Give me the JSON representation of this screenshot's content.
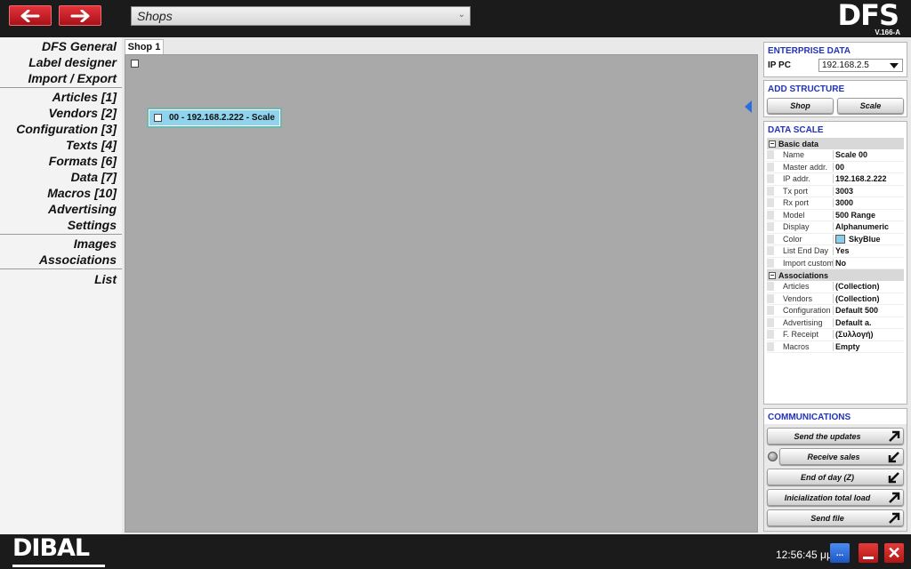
{
  "header": {
    "shops_select_value": "Shops",
    "logo": "DFS",
    "version": "V.166-A"
  },
  "sidebar": {
    "group1": [
      "DFS General",
      "Label designer",
      "Import / Export"
    ],
    "group2": [
      "Articles [1]",
      "Vendors [2]",
      "Configuration [3]",
      "Texts [4]",
      "Formats [6]",
      "Data [7]",
      "Macros [10]",
      "Advertising",
      "Settings"
    ],
    "group3": [
      "Images",
      "Associations"
    ],
    "group4": [
      "List"
    ]
  },
  "main": {
    "tab_label": "Shop 1",
    "scale_node_label": "00 - 192.168.2.222 - Scale"
  },
  "enterprise": {
    "title": "ENTERPRISE DATA",
    "ip_label": "IP PC",
    "ip_value": "192.168.2.5"
  },
  "structure": {
    "title": "ADD STRUCTURE",
    "shop_button": "Shop",
    "scale_button": "Scale"
  },
  "data_scale": {
    "title": "DATA SCALE",
    "basic_group": "Basic data",
    "basic": [
      {
        "k": "Name",
        "v": "Scale 00"
      },
      {
        "k": "Master addr.",
        "v": "00"
      },
      {
        "k": "IP addr.",
        "v": "192.168.2.222"
      },
      {
        "k": "Tx port",
        "v": "3003"
      },
      {
        "k": "Rx port",
        "v": "3000"
      },
      {
        "k": "Model",
        "v": "500 Range"
      },
      {
        "k": "Display",
        "v": "Alphanumeric"
      },
      {
        "k": "Color",
        "v": "SkyBlue"
      },
      {
        "k": "List End Day",
        "v": "Yes"
      },
      {
        "k": "Import custom",
        "v": "No"
      }
    ],
    "assoc_group": "Associations",
    "assoc": [
      {
        "k": "Articles",
        "v": "(Collection)"
      },
      {
        "k": "Vendors",
        "v": "(Collection)"
      },
      {
        "k": "Configuration",
        "v": "Default 500"
      },
      {
        "k": "Advertising",
        "v": "Default a."
      },
      {
        "k": "F. Receipt",
        "v": "(Συλλογή)"
      },
      {
        "k": "Macros",
        "v": "Empty"
      }
    ],
    "color_swatch": "#87ceeb"
  },
  "communications": {
    "title": "COMMUNICATIONS",
    "buttons": [
      "Send the updates",
      "Receive sales",
      "End of day (Z)",
      "Inicialization total load",
      "Send file"
    ]
  },
  "footer": {
    "brand": "DIBAL",
    "clock": "12:56:45 μμ",
    "dots_button": "..."
  },
  "colors": {
    "accent_red": "#d0202a",
    "title_blue": "#2233bb",
    "node_fill": "#8fd3ec"
  }
}
